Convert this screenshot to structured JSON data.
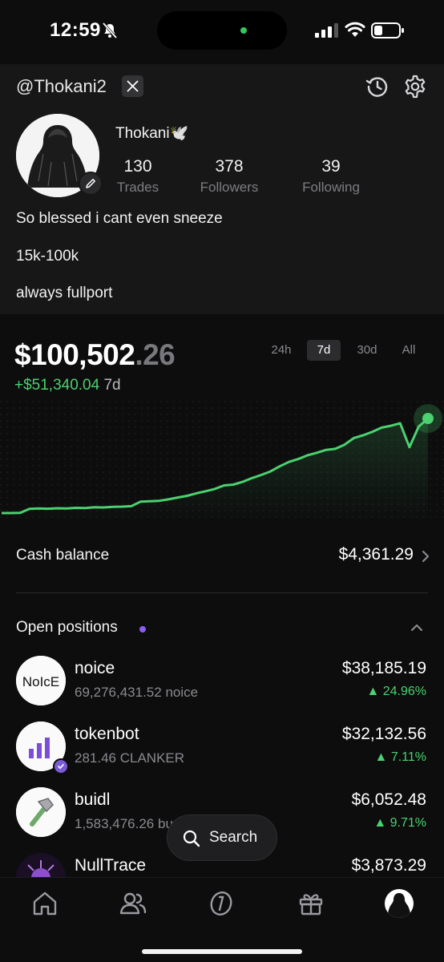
{
  "status_bar": {
    "time": "12:59"
  },
  "profile": {
    "handle": "@Thokani2",
    "display_name": "Thokani🕊️",
    "stats": [
      {
        "value": "130",
        "label": "Trades"
      },
      {
        "value": "378",
        "label": "Followers"
      },
      {
        "value": "39",
        "label": "Following"
      }
    ],
    "bio": [
      "So blessed i cant even sneeze",
      "15k-100k",
      "always fullport"
    ]
  },
  "portfolio": {
    "value_main": "$100,502",
    "value_cents": ".26",
    "change": "+$51,340.04",
    "change_period": "7d",
    "ranges": [
      "24h",
      "7d",
      "30d",
      "All"
    ],
    "active_range": "7d",
    "line_color": "#4bd16f"
  },
  "chart_data": {
    "type": "line",
    "title": "",
    "xlabel": "",
    "ylabel": "",
    "series": [
      {
        "values": [
          55000,
          55000,
          55100,
          57000,
          57200,
          57100,
          57300,
          57200,
          57500,
          57400,
          57800,
          57700,
          58000,
          58100,
          58300,
          60500,
          60700,
          60900,
          61600,
          62500,
          63300,
          64500,
          65500,
          66600,
          68300,
          68700,
          70000,
          71800,
          73300,
          75000,
          77500,
          79600,
          81000,
          82800,
          84000,
          85400,
          85900,
          87900,
          91100,
          92400,
          94100,
          96100,
          97000,
          98200,
          86700,
          96600,
          100502
        ]
      }
    ]
  },
  "cash": {
    "label": "Cash balance",
    "value": "$4,361.29"
  },
  "positions": {
    "title": "Open positions",
    "items": [
      {
        "name": "noice",
        "amount": "69,276,431.52 noice",
        "value": "$38,185.19",
        "change": "▲ 24.96%",
        "logo": "NoIcE"
      },
      {
        "name": "tokenbot",
        "amount": "281.46 CLANKER",
        "value": "$32,132.56",
        "change": "▲ 7.11%"
      },
      {
        "name": "buidl",
        "amount": "1,583,476.26 bu",
        "value": "$6,052.48",
        "change": "▲ 9.71%"
      },
      {
        "name": "NullTrace",
        "amount": "",
        "value": "$3,873.29",
        "change": ""
      }
    ]
  },
  "search": {
    "label": "Search"
  },
  "tabs": [
    "home-icon",
    "people-icon",
    "coin-icon",
    "gift-icon",
    "profile-avatar"
  ]
}
